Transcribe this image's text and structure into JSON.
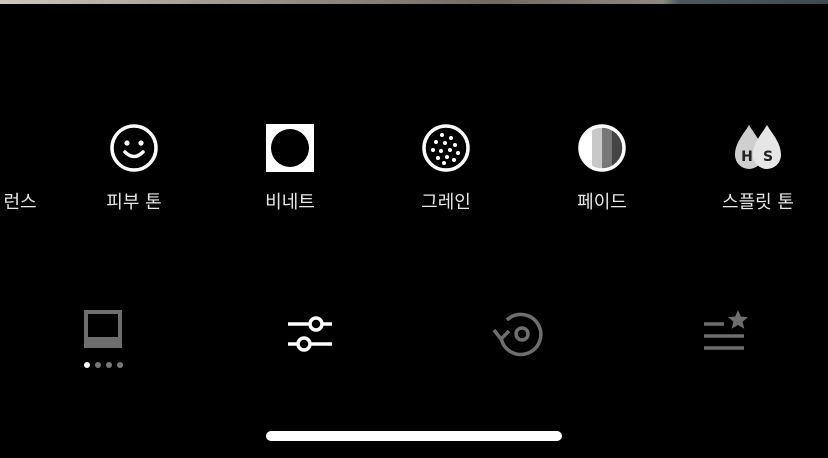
{
  "tools": [
    {
      "label": "런스",
      "icon": "partial-tool-icon"
    },
    {
      "label": "피부 톤",
      "icon": "smiley-face-icon"
    },
    {
      "label": "비네트",
      "icon": "vignette-icon"
    },
    {
      "label": "그레인",
      "icon": "grain-icon"
    },
    {
      "label": "페이드",
      "icon": "fade-icon"
    },
    {
      "label": "스플릿 톤",
      "icon": "split-tone-icon"
    }
  ],
  "split_tone_letters": {
    "h": "H",
    "s": "S"
  },
  "bottom_tabs": [
    {
      "name": "filters-tab",
      "icon": "filter-frame-icon"
    },
    {
      "name": "edit-tab",
      "icon": "sliders-icon"
    },
    {
      "name": "history-tab",
      "icon": "revert-history-icon"
    },
    {
      "name": "presets-tab",
      "icon": "starred-list-icon"
    }
  ],
  "colors": {
    "background": "#000000",
    "active": "#ffffff",
    "inactive": "#6e6e6e"
  }
}
